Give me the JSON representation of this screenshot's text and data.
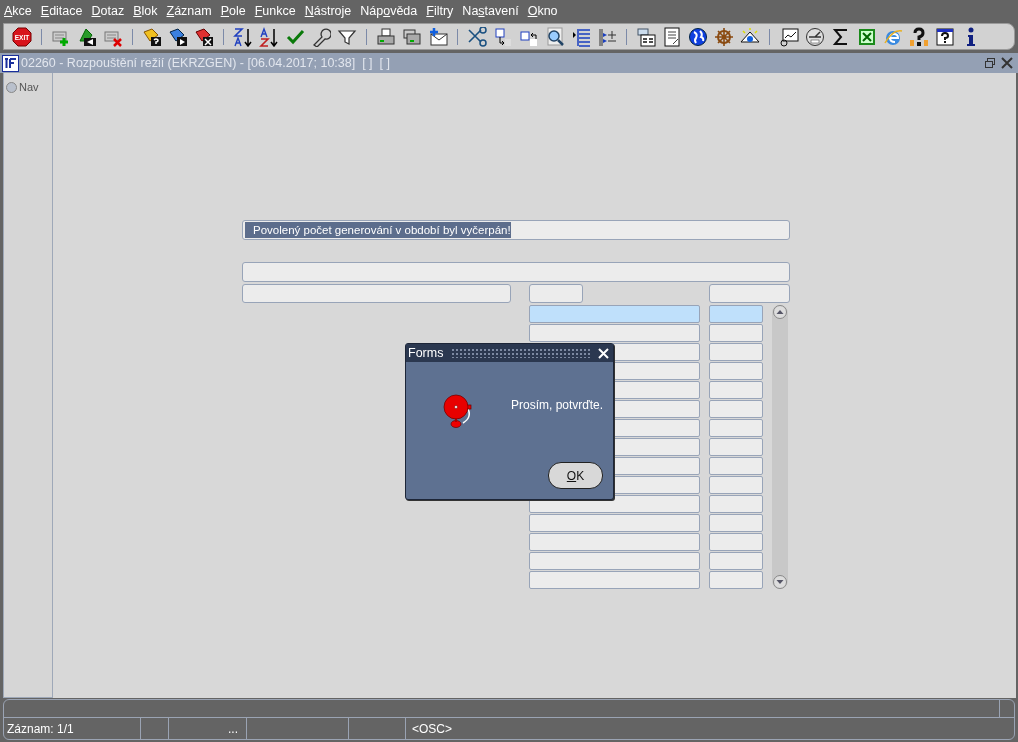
{
  "menu": [
    {
      "key": "A",
      "after": "kce"
    },
    {
      "key": "E",
      "after": "ditace"
    },
    {
      "key": "D",
      "after": "otaz"
    },
    {
      "key": "B",
      "after": "lok"
    },
    {
      "key": "Z",
      "after": "áznam"
    },
    {
      "key": "P",
      "after": "ole"
    },
    {
      "key": "F",
      "after": "unkce"
    },
    {
      "key": "N",
      "after": "ástroje"
    },
    {
      "before": "Náp",
      "key": "o",
      "after": "věda"
    },
    {
      "key": "F",
      "after": "iltry"
    },
    {
      "before": "Na",
      "key": "s",
      "after": "tavení"
    },
    {
      "key": "O",
      "after": "kno"
    }
  ],
  "toolbar": {
    "exit_label": "EXIT"
  },
  "window": {
    "title": "02260 - Rozpouštění režií (EKRZGEN) - [06.04.2017; 10:38]  [ ]  [ ]"
  },
  "sidebar": {
    "items": [
      {
        "label": "Nav",
        "selected": false
      }
    ]
  },
  "form": {
    "message": {
      "value": "Povolený počet generování v období byl vyčerpán!",
      "highlighted": true
    }
  },
  "table": {
    "rows": [
      {
        "selected": true
      },
      {
        "selected": false
      },
      {
        "selected": false
      },
      {
        "selected": false
      },
      {
        "selected": false
      },
      {
        "selected": false
      },
      {
        "selected": false
      },
      {
        "selected": false
      },
      {
        "selected": false
      },
      {
        "selected": false
      },
      {
        "selected": false
      },
      {
        "selected": false
      },
      {
        "selected": false
      },
      {
        "selected": false
      },
      {
        "selected": false
      }
    ]
  },
  "dialog": {
    "title": "Forms",
    "message": "Prosím, potvrďte.",
    "button": {
      "key": "O",
      "after": "K"
    }
  },
  "status_bar": {
    "record": "Záznam: 1/1",
    "cell_3": "...",
    "mode": "<OSC>"
  }
}
